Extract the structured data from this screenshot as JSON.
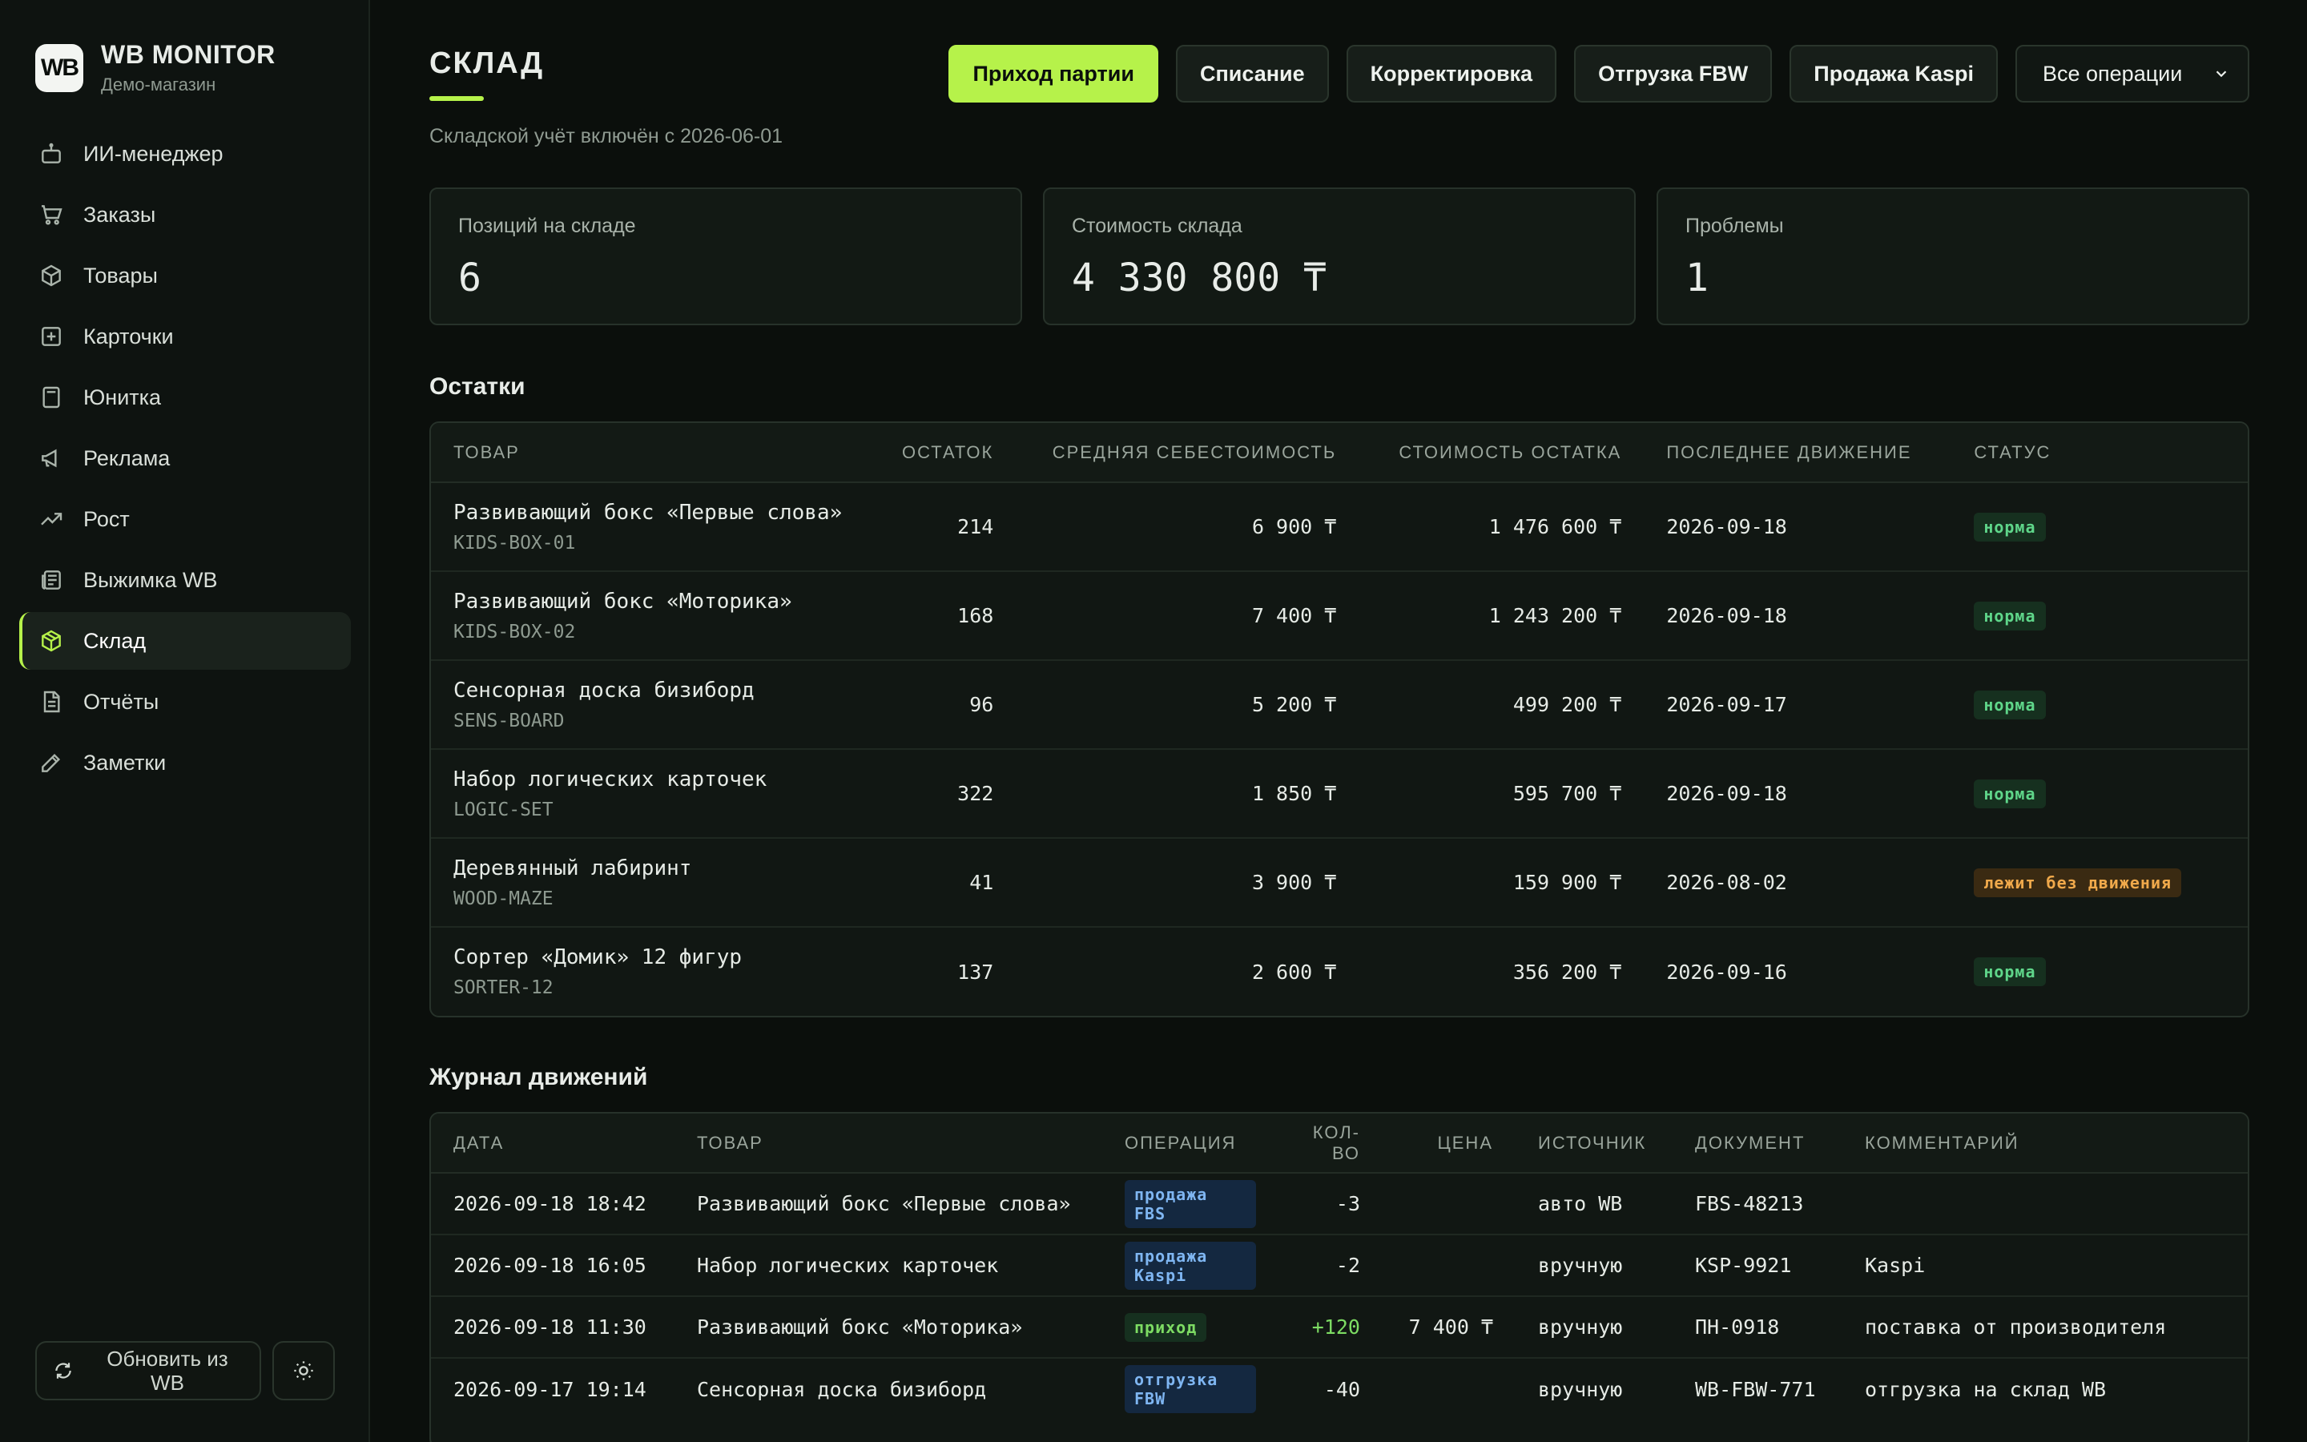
{
  "brand": {
    "logo": "WB",
    "title": "WB MONITOR",
    "subtitle": "Демо-магазин"
  },
  "nav": [
    {
      "label": "ИИ-менеджер",
      "icon": "robot-icon"
    },
    {
      "label": "Заказы",
      "icon": "cart-icon"
    },
    {
      "label": "Товары",
      "icon": "box-icon"
    },
    {
      "label": "Карточки",
      "icon": "plus-square-icon"
    },
    {
      "label": "Юнитка",
      "icon": "calculator-icon"
    },
    {
      "label": "Реклама",
      "icon": "megaphone-icon"
    },
    {
      "label": "Рост",
      "icon": "trending-up-icon"
    },
    {
      "label": "Выжимка WB",
      "icon": "newspaper-icon"
    },
    {
      "label": "Склад",
      "icon": "warehouse-box-icon",
      "active": true
    },
    {
      "label": "Отчёты",
      "icon": "file-text-icon"
    },
    {
      "label": "Заметки",
      "icon": "pencil-icon"
    }
  ],
  "sidebar_footer": {
    "refresh_label": "Обновить из WB"
  },
  "page": {
    "title": "СКЛАД",
    "subtitle": "Складской учёт включён с 2026-06-01"
  },
  "toolbar": {
    "buttons": [
      "Приход партии",
      "Списание",
      "Корректировка",
      "Отгрузка FBW",
      "Продажа Kaspi"
    ],
    "select_value": "Все операции"
  },
  "stats": [
    {
      "label": "Позиций на складе",
      "value": "6"
    },
    {
      "label": "Стоимость склада",
      "value": "4 330 800 ₸"
    },
    {
      "label": "Проблемы",
      "value": "1"
    }
  ],
  "stock": {
    "title": "Остатки",
    "headers": [
      "ТОВАР",
      "ОСТАТОК",
      "СРЕДНЯЯ СЕБЕСТОИМОСТЬ",
      "СТОИМОСТЬ ОСТАТКА",
      "ПОСЛЕДНЕЕ ДВИЖЕНИЕ",
      "СТАТУС"
    ],
    "rows": [
      {
        "name": "Развивающий бокс «Первые слова»",
        "sku": "KIDS-BOX-01",
        "qty": "214",
        "avg": "6 900 ₸",
        "total": "1 476 600 ₸",
        "last": "2026-09-18",
        "status": "норма",
        "status_type": "norm"
      },
      {
        "name": "Развивающий бокс «Моторика»",
        "sku": "KIDS-BOX-02",
        "qty": "168",
        "avg": "7 400 ₸",
        "total": "1 243 200 ₸",
        "last": "2026-09-18",
        "status": "норма",
        "status_type": "norm"
      },
      {
        "name": "Сенсорная доска бизиборд",
        "sku": "SENS-BOARD",
        "qty": "96",
        "avg": "5 200 ₸",
        "total": "499 200 ₸",
        "last": "2026-09-17",
        "status": "норма",
        "status_type": "norm"
      },
      {
        "name": "Набор логических карточек",
        "sku": "LOGIC-SET",
        "qty": "322",
        "avg": "1 850 ₸",
        "total": "595 700 ₸",
        "last": "2026-09-18",
        "status": "норма",
        "status_type": "norm"
      },
      {
        "name": "Деревянный лабиринт",
        "sku": "WOOD-MAZE",
        "qty": "41",
        "avg": "3 900 ₸",
        "total": "159 900 ₸",
        "last": "2026-08-02",
        "status": "лежит без движения",
        "status_type": "stale"
      },
      {
        "name": "Сортер «Домик» 12 фигур",
        "sku": "SORTER-12",
        "qty": "137",
        "avg": "2 600 ₸",
        "total": "356 200 ₸",
        "last": "2026-09-16",
        "status": "норма",
        "status_type": "norm"
      }
    ]
  },
  "log": {
    "title": "Журнал движений",
    "headers": [
      "ДАТА",
      "ТОВАР",
      "ОПЕРАЦИЯ",
      "КОЛ-ВО",
      "ЦЕНА",
      "ИСТОЧНИК",
      "ДОКУМЕНТ",
      "КОММЕНТАРИЙ"
    ],
    "rows": [
      {
        "date": "2026-09-18 18:42",
        "product": "Развивающий бокс «Первые слова»",
        "op": "продажа FBS",
        "op_type": "fbs",
        "qty": "-3",
        "price": "",
        "source": "авто WB",
        "doc": "FBS-48213",
        "comment": ""
      },
      {
        "date": "2026-09-18 16:05",
        "product": "Набор логических карточек",
        "op": "продажа Kaspi",
        "op_type": "kaspi",
        "qty": "-2",
        "price": "",
        "source": "вручную",
        "doc": "KSP-9921",
        "comment": "Kaspi"
      },
      {
        "date": "2026-09-18 11:30",
        "product": "Развивающий бокс «Моторика»",
        "op": "приход",
        "op_type": "in",
        "qty": "+120",
        "price": "7 400 ₸",
        "source": "вручную",
        "doc": "ПН-0918",
        "comment": "поставка от производителя"
      },
      {
        "date": "2026-09-17 19:14",
        "product": "Сенсорная доска бизиборд",
        "op": "отгрузка FBW",
        "op_type": "fbw",
        "qty": "-40",
        "price": "",
        "source": "вручную",
        "doc": "WB-FBW-771",
        "comment": "отгрузка на склад WB"
      }
    ]
  },
  "colors": {
    "accent": "#b6f24a",
    "background": "#0b0f0c",
    "status_ok": "#5fd68a",
    "status_warn": "#f0a94b"
  }
}
